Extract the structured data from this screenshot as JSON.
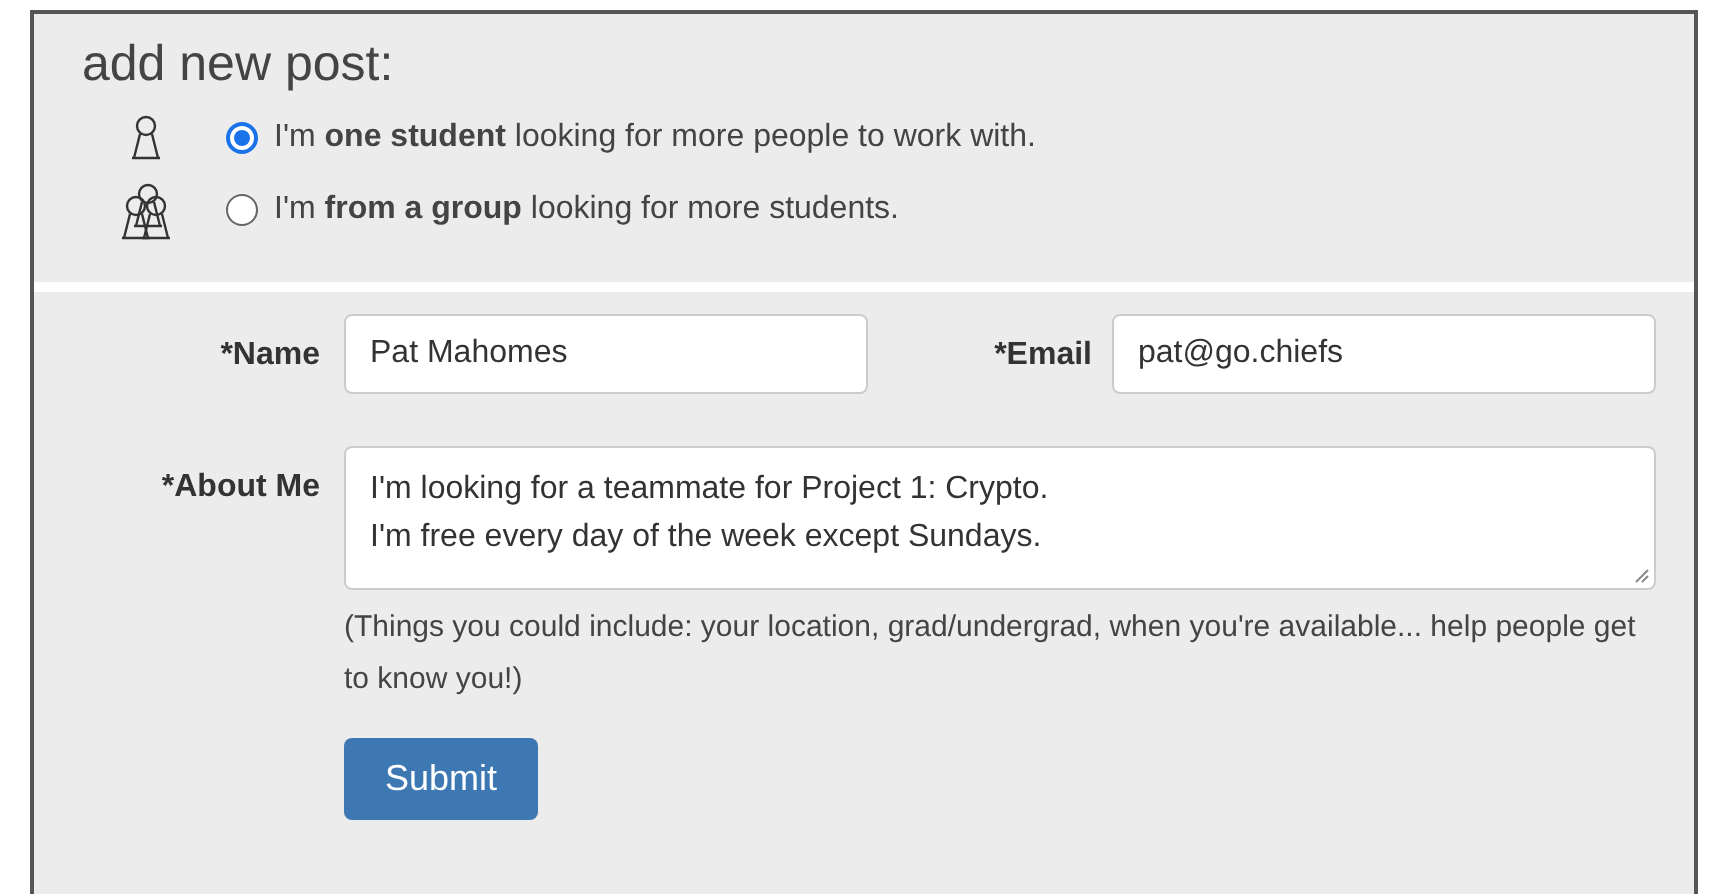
{
  "heading": "add new post:",
  "options": [
    {
      "kind": "single",
      "label": "I'm **one student** looking for more people to work with.",
      "selected": true
    },
    {
      "kind": "group",
      "label": "I'm **from a group** looking for more students.",
      "selected": false
    }
  ],
  "form": {
    "name": {
      "label": "*Name",
      "value": "Pat Mahomes"
    },
    "email": {
      "label": "*Email",
      "value": "pat@go.chiefs"
    },
    "about": {
      "label": "*About Me",
      "lines": [
        "I'm looking for a teammate for Project 1: Crypto.",
        "I'm free every day of the week except Sundays."
      ]
    },
    "help": "(Things you could include: your location, grad/undergrad, when you're available... help people get to know you!)",
    "submit": "Submit"
  }
}
